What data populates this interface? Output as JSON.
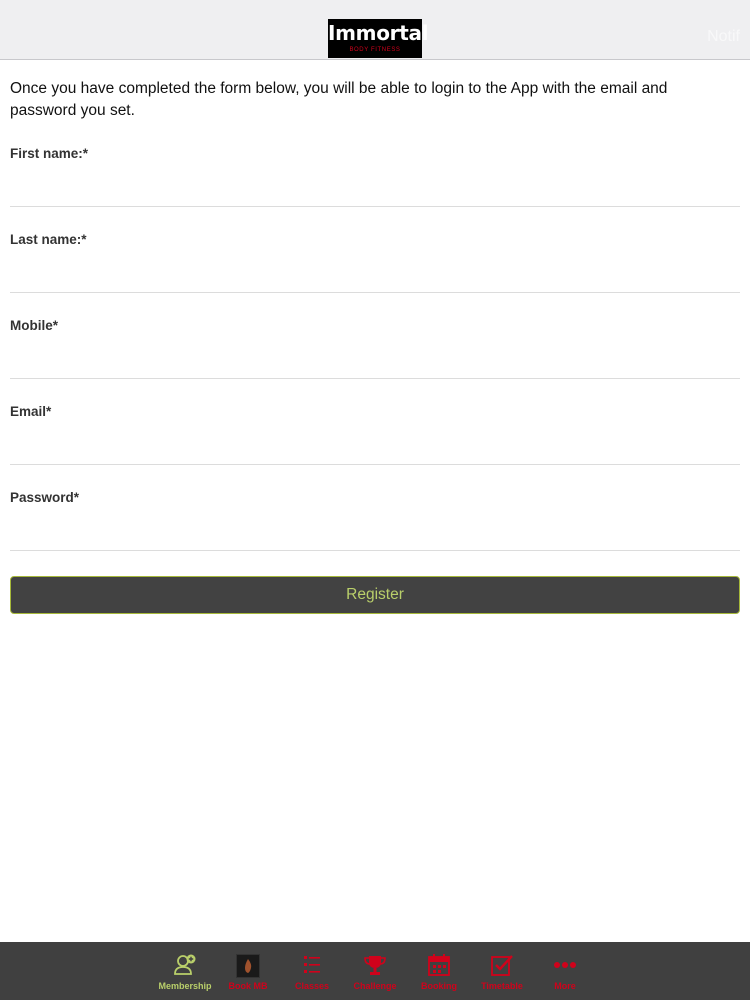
{
  "header": {
    "logo_main": "Immortal",
    "logo_sub": "BODY FITNESS",
    "right_label": "Notif"
  },
  "intro": "Once you have completed the form below, you will be able to login to the App with the email and password you set.",
  "form": {
    "fields": [
      {
        "label": "First name:*",
        "value": "",
        "placeholder": ""
      },
      {
        "label": "Last name:*",
        "value": "",
        "placeholder": ""
      },
      {
        "label": "Mobile*",
        "value": "",
        "placeholder": ""
      },
      {
        "label": "Email*",
        "value": "",
        "placeholder": ""
      },
      {
        "label": "Password*",
        "value": "",
        "placeholder": ""
      }
    ],
    "register_label": "Register"
  },
  "tabbar": {
    "active_color": "#b9cf6a",
    "inactive_color": "#d0021b",
    "background": "#404040",
    "items": [
      {
        "label": "Membership",
        "icon": "membership-user-icon",
        "active": true
      },
      {
        "label": "Book MB",
        "icon": "app-thumbnail-icon",
        "active": false
      },
      {
        "label": "Classes",
        "icon": "list-icon",
        "active": false
      },
      {
        "label": "Challenge",
        "icon": "trophy-icon",
        "active": false
      },
      {
        "label": "Booking",
        "icon": "calendar-icon",
        "active": false
      },
      {
        "label": "Timetable",
        "icon": "checklist-icon",
        "active": false
      },
      {
        "label": "More",
        "icon": "more-dots-icon",
        "active": false
      }
    ]
  }
}
